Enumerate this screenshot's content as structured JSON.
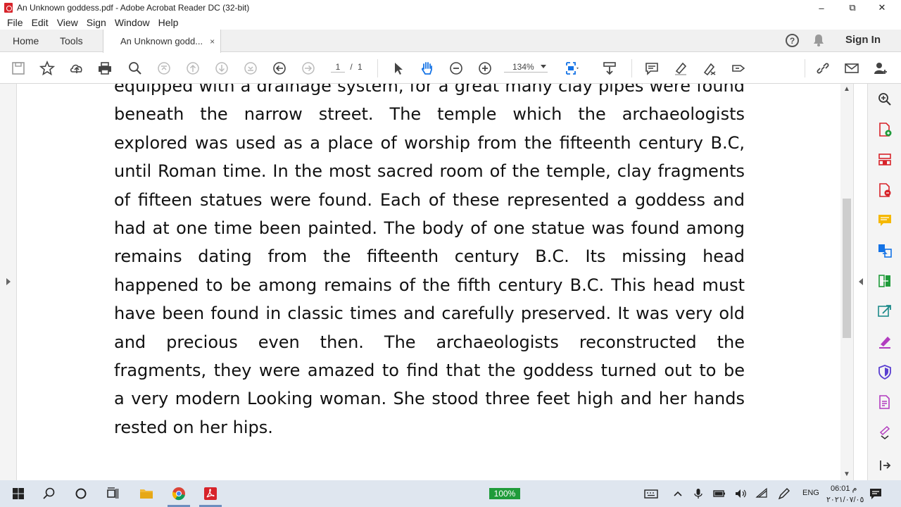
{
  "window": {
    "title": "An Unknown goddess.pdf - Adobe Acrobat Reader DC (32-bit)",
    "minimize": "–",
    "maximize": "⧉",
    "close": "✕"
  },
  "menu": [
    "File",
    "Edit",
    "View",
    "Sign",
    "Window",
    "Help"
  ],
  "tabs": {
    "home": "Home",
    "tools": "Tools",
    "document": "An Unknown godd...",
    "close": "×"
  },
  "header": {
    "help": "?",
    "sign_in": "Sign In"
  },
  "toolbar": {
    "page_current": "1",
    "page_sep": "/",
    "page_total": "1",
    "zoom": "134%"
  },
  "document": {
    "lines": [
      "equipped with a drainage system, for a great many clay pipes were found",
      "beneath the narrow street. The temple which the archaeologists",
      "explored was used as a place of worship from the fifteenth century B.C,",
      "until Roman time. In the most sacred room of the temple, clay fragments",
      "of fifteen statues were found. Each of these represented a goddess and",
      "had at one time been painted. The body of one statue was found among",
      "remains dating from the fifteenth century B.C. Its missing head",
      "happened to be among remains of the fifth century B.C. This head must",
      "have been found in classic times and carefully preserved. It was very old",
      "and precious even then. The archaeologists reconstructed the",
      "fragments, they were amazed to find that the goddess turned out to be",
      "a very modern Looking woman. She stood three feet high and her hands",
      "rested on her hips."
    ]
  },
  "taskbar": {
    "battery": "100%",
    "language": "ENG",
    "time": "06:01 م",
    "date": "٢٠٢١/٠٧/٠٥"
  },
  "colors": {
    "acrobat_red": "#d7232a",
    "toolbar_blue": "#1473e6",
    "battery_green": "#1f9b3a",
    "taskbar_bg": "#dfe6ef"
  }
}
